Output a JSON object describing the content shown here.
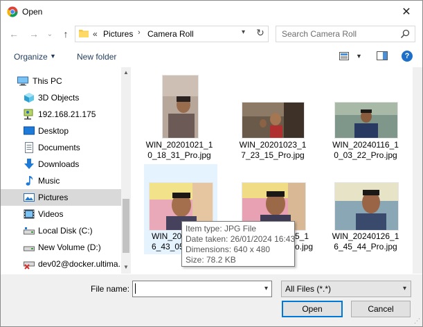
{
  "window": {
    "title": "Open"
  },
  "nav": {
    "back_glyph": "←",
    "forward_glyph": "→",
    "recent_glyph": "⌄",
    "up_glyph": "↑"
  },
  "address": {
    "overflow": "«",
    "crumbs": [
      "Pictures",
      "Camera Roll"
    ],
    "separator": "›"
  },
  "search": {
    "placeholder": "Search Camera Roll"
  },
  "toolbar": {
    "organize_label": "Organize",
    "new_folder_label": "New folder",
    "help_label": "?"
  },
  "sidebar": {
    "items": [
      {
        "label": "This PC",
        "icon": "computer-icon"
      },
      {
        "label": "3D Objects",
        "icon": "cube-icon"
      },
      {
        "label": "192.168.21.175",
        "icon": "network-drive-icon"
      },
      {
        "label": "Desktop",
        "icon": "desktop-icon"
      },
      {
        "label": "Documents",
        "icon": "documents-icon"
      },
      {
        "label": "Downloads",
        "icon": "download-icon"
      },
      {
        "label": "Music",
        "icon": "music-icon"
      },
      {
        "label": "Pictures",
        "icon": "pictures-icon",
        "selected": true
      },
      {
        "label": "Videos",
        "icon": "videos-icon"
      },
      {
        "label": "Local Disk (C:)",
        "icon": "disk-icon"
      },
      {
        "label": "New Volume (D:)",
        "icon": "disk-icon"
      },
      {
        "label": "dev02@docker.ultima...",
        "icon": "disconnected-drive-icon"
      }
    ]
  },
  "files": [
    {
      "line1": "WIN_20201021_1",
      "line2": "0_18_31_Pro.jpg"
    },
    {
      "line1": "WIN_20201023_1",
      "line2": "7_23_15_Pro.jpg"
    },
    {
      "line1": "WIN_20240116_1",
      "line2": "0_03_22_Pro.jpg"
    },
    {
      "line1": "WIN_202",
      "line2": "6_43_05"
    },
    {
      "line1": "",
      "line2": ""
    },
    {
      "line1": "WIN_20240126_1",
      "line2": "6_45_44_Pro.jpg"
    }
  ],
  "files_partial": {
    "tile5_line1_tail": "5_1",
    "tile5_line2_tail": "o.jpg"
  },
  "tooltip": {
    "type": "Item type: JPG File",
    "date": "Date taken: 26/01/2024 16:43",
    "dimensions": "Dimensions: 640 x 480",
    "size": "Size: 78.2 KB"
  },
  "bottom": {
    "file_name_label": "File name:",
    "file_name_value": "",
    "file_type_value": "All Files (*.*)",
    "open_label": "Open",
    "cancel_label": "Cancel"
  },
  "colors": {
    "selection": "#d9d9d9",
    "hover_tile": "#e5f3ff",
    "accent": "#0078d7"
  }
}
